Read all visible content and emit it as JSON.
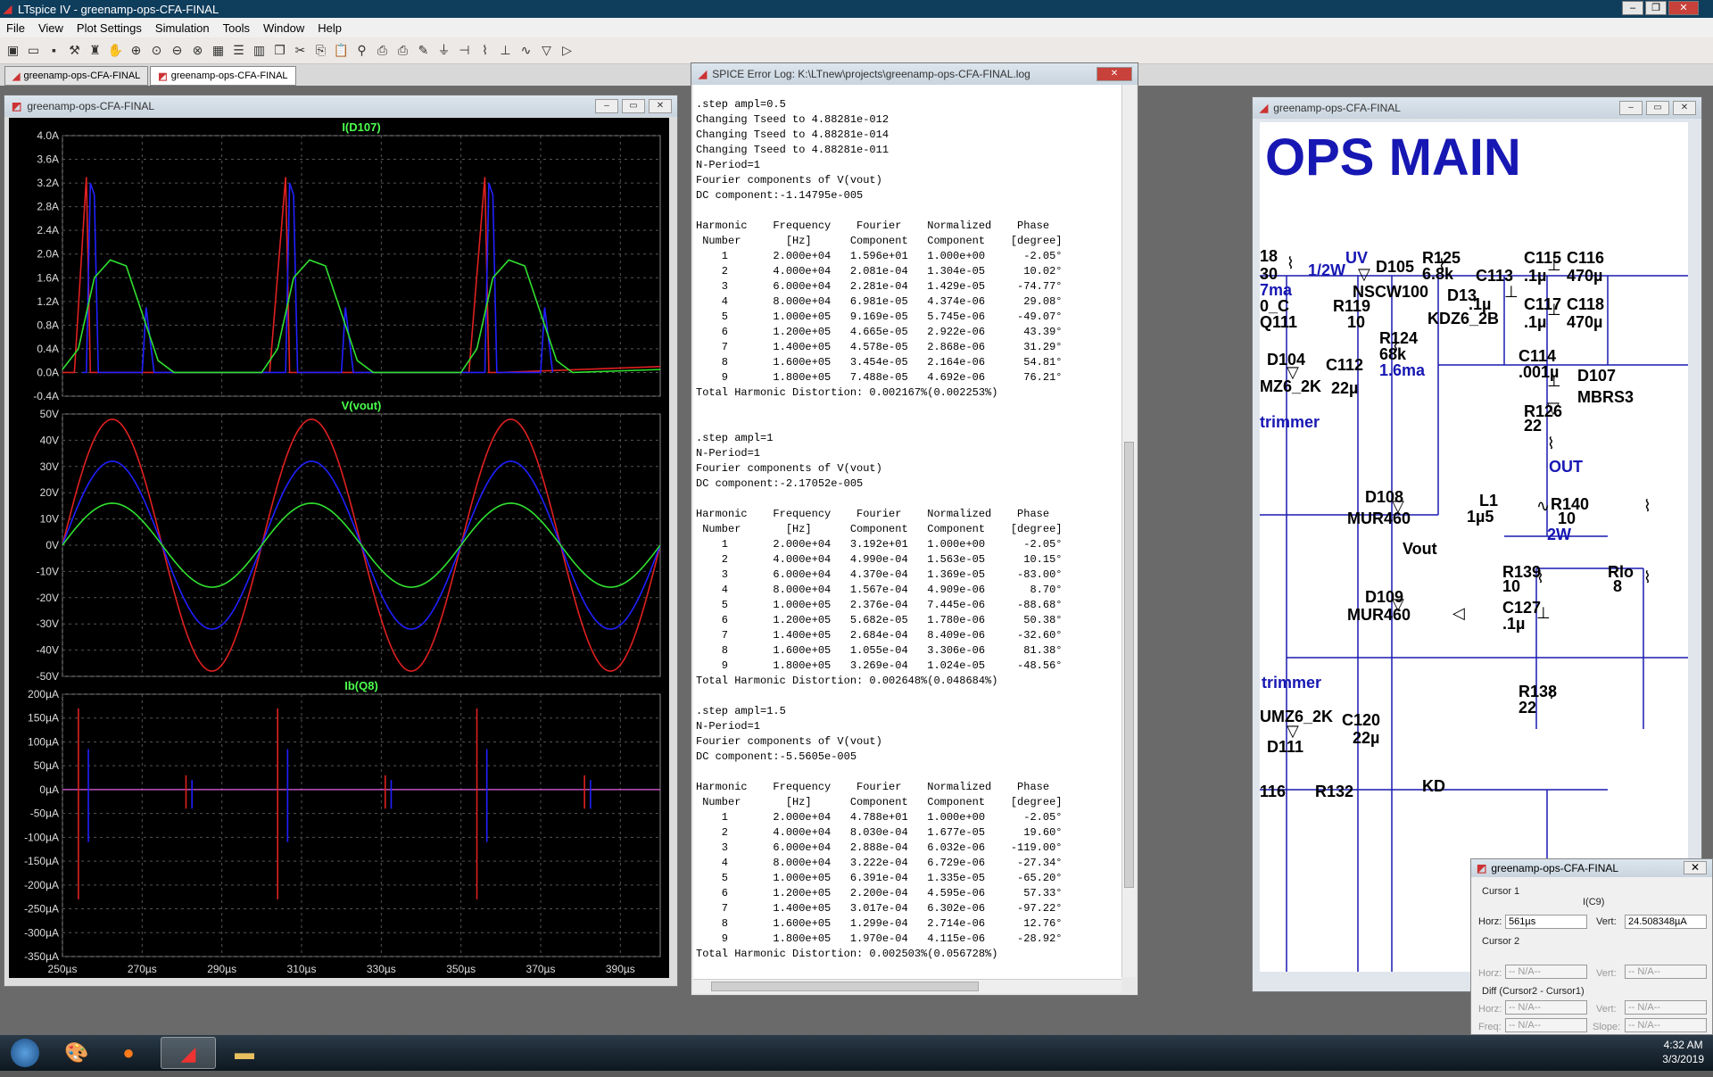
{
  "app": {
    "title": "LTspice IV - greenamp-ops-CFA-FINAL",
    "menu": [
      "File",
      "View",
      "Plot Settings",
      "Simulation",
      "Tools",
      "Window",
      "Help"
    ],
    "tabs": [
      "greenamp-ops-CFA-FINAL",
      "greenamp-ops-CFA-FINAL"
    ]
  },
  "waveform_window": {
    "title": "greenamp-ops-CFA-FINAL",
    "panes": [
      {
        "title": "I(D107)",
        "color": "#4cff4c",
        "yticks": [
          "4.0A",
          "3.6A",
          "3.2A",
          "2.8A",
          "2.4A",
          "2.0A",
          "1.6A",
          "1.2A",
          "0.8A",
          "0.4A",
          "0.0A",
          "-0.4A"
        ]
      },
      {
        "title": "V(vout)",
        "color": "#4cff4c",
        "yticks": [
          "50V",
          "40V",
          "30V",
          "20V",
          "10V",
          "0V",
          "-10V",
          "-20V",
          "-30V",
          "-40V",
          "-50V"
        ]
      },
      {
        "title": "Ib(Q8)",
        "color": "#4cff4c",
        "yticks": [
          "200µA",
          "150µA",
          "100µA",
          "50µA",
          "0µA",
          "-50µA",
          "-100µA",
          "-150µA",
          "-200µA",
          "-250µA",
          "-300µA",
          "-350µA"
        ]
      }
    ],
    "xticks": [
      "250µs",
      "270µs",
      "290µs",
      "310µs",
      "330µs",
      "350µs",
      "370µs",
      "390µs"
    ]
  },
  "chart_data": [
    {
      "type": "line",
      "title": "I(D107)",
      "ylim": [
        -0.4,
        4.0
      ],
      "xlim": [
        250,
        400
      ],
      "x_unit": "µs",
      "y_unit": "A",
      "series": [
        {
          "color": "#e02020",
          "x": [
            250,
            253,
            256,
            257,
            258,
            260,
            299,
            302,
            306,
            307,
            308,
            349,
            352,
            356,
            357,
            358,
            360,
            400
          ],
          "values": [
            0,
            0,
            3.3,
            0,
            0,
            0,
            0,
            0,
            3.3,
            0,
            0,
            0,
            0,
            3.3,
            0,
            0,
            0,
            0.1
          ]
        },
        {
          "color": "#2020ff",
          "x": [
            255,
            256,
            257,
            258,
            259,
            270,
            271,
            273,
            305,
            306,
            307,
            308,
            309,
            320,
            321,
            323,
            355,
            356,
            357,
            358,
            359,
            370,
            371,
            373
          ],
          "values": [
            0,
            0,
            3.2,
            3.0,
            0,
            0,
            1.1,
            0,
            0,
            0,
            3.2,
            3.0,
            0,
            0,
            1.1,
            0,
            0,
            0,
            3.2,
            3.0,
            0,
            0,
            1.1,
            0
          ]
        },
        {
          "color": "#30e030",
          "x": [
            250,
            254,
            258,
            262,
            266,
            270,
            274,
            278,
            300,
            304,
            308,
            312,
            316,
            320,
            324,
            328,
            350,
            354,
            358,
            362,
            366,
            370,
            374,
            378,
            400
          ],
          "values": [
            0.05,
            0.4,
            1.6,
            1.9,
            1.8,
            1.0,
            0.2,
            0,
            0,
            0.4,
            1.6,
            1.9,
            1.8,
            1.0,
            0.2,
            0,
            0,
            0.4,
            1.6,
            1.9,
            1.8,
            1.0,
            0.2,
            0,
            0.05
          ]
        }
      ]
    },
    {
      "type": "line",
      "title": "V(vout)",
      "ylim": [
        -50,
        50
      ],
      "xlim": [
        250,
        400
      ],
      "x_unit": "µs",
      "y_unit": "V",
      "period_us": 50,
      "series": [
        {
          "color": "#e02020",
          "amplitude": 48
        },
        {
          "color": "#2020ff",
          "amplitude": 32
        },
        {
          "color": "#30e030",
          "amplitude": 16
        }
      ]
    },
    {
      "type": "line",
      "title": "Ib(Q8)",
      "ylim": [
        -350,
        200
      ],
      "xlim": [
        250,
        400
      ],
      "x_unit": "µs",
      "y_unit": "µA",
      "spikes": [
        {
          "color": "#e02020",
          "x": [
            254,
            304,
            354
          ],
          "top": [
            170,
            170,
            170
          ],
          "bottom": [
            -230,
            -230,
            -230
          ]
        },
        {
          "color": "#2020ff",
          "x": [
            256.5,
            306.5,
            356.5
          ],
          "top": [
            85,
            85,
            85
          ],
          "bottom": [
            -110,
            -110,
            -110
          ]
        },
        {
          "color": "#e02020",
          "x": [
            281,
            331,
            381
          ],
          "top": [
            30,
            30,
            30
          ],
          "bottom": [
            -40,
            -40,
            -40
          ]
        },
        {
          "color": "#2020ff",
          "x": [
            282.5,
            332.5,
            382.5
          ],
          "top": [
            20,
            20,
            20
          ],
          "bottom": [
            -40,
            -40,
            -40
          ]
        }
      ]
    }
  ],
  "log_window": {
    "title": "SPICE Error Log: K:\\LTnew\\projects\\greenamp-ops-CFA-FINAL.log",
    "lines": [
      ".step ampl=0.5",
      "Changing Tseed to 4.88281e-012",
      "Changing Tseed to 4.88281e-014",
      "Changing Tseed to 4.88281e-011",
      "N-Period=1",
      "Fourier components of V(vout)",
      "DC component:-1.14795e-005",
      "",
      "Harmonic    Frequency    Fourier    Normalized    Phase",
      " Number       [Hz]      Component   Component    [degree]",
      "    1       2.000e+04   1.596e+01   1.000e+00      -2.05°",
      "    2       4.000e+04   2.081e-04   1.304e-05      10.02°",
      "    3       6.000e+04   2.281e-04   1.429e-05     -74.77°",
      "    4       8.000e+04   6.981e-05   4.374e-06      29.08°",
      "    5       1.000e+05   9.169e-05   5.745e-06     -49.07°",
      "    6       1.200e+05   4.665e-05   2.922e-06      43.39°",
      "    7       1.400e+05   4.578e-05   2.868e-06      31.29°",
      "    8       1.600e+05   3.454e-05   2.164e-06      54.81°",
      "    9       1.800e+05   7.488e-05   4.692e-06      76.21°",
      "Total Harmonic Distortion: 0.002167%(0.002253%)",
      "",
      "",
      ".step ampl=1",
      "N-Period=1",
      "Fourier components of V(vout)",
      "DC component:-2.17052e-005",
      "",
      "Harmonic    Frequency    Fourier    Normalized    Phase",
      " Number       [Hz]      Component   Component    [degree]",
      "    1       2.000e+04   3.192e+01   1.000e+00      -2.05°",
      "    2       4.000e+04   4.990e-04   1.563e-05      10.15°",
      "    3       6.000e+04   4.370e-04   1.369e-05     -83.00°",
      "    4       8.000e+04   1.567e-04   4.909e-06       8.70°",
      "    5       1.000e+05   2.376e-04   7.445e-06     -88.68°",
      "    6       1.200e+05   5.682e-05   1.780e-06      50.38°",
      "    7       1.400e+05   2.684e-04   8.409e-06     -32.60°",
      "    8       1.600e+05   1.055e-04   3.306e-06      81.38°",
      "    9       1.800e+05   3.269e-04   1.024e-05     -48.56°",
      "Total Harmonic Distortion: 0.002648%(0.048684%)",
      "",
      ".step ampl=1.5",
      "N-Period=1",
      "Fourier components of V(vout)",
      "DC component:-5.5605e-005",
      "",
      "Harmonic    Frequency    Fourier    Normalized    Phase",
      " Number       [Hz]      Component   Component    [degree]",
      "    1       2.000e+04   4.788e+01   1.000e+00      -2.05°",
      "    2       4.000e+04   8.030e-04   1.677e-05      19.60°",
      "    3       6.000e+04   2.888e-04   6.032e-06    -119.00°",
      "    4       8.000e+04   3.222e-04   6.729e-06     -27.34°",
      "    5       1.000e+05   6.391e-04   1.335e-05     -65.20°",
      "    6       1.200e+05   2.200e-04   4.595e-06      57.33°",
      "    7       1.400e+05   3.017e-04   6.302e-06     -97.22°",
      "    8       1.600e+05   1.299e-04   2.714e-06      12.76°",
      "    9       1.800e+05   1.970e-04   4.115e-06     -28.92°",
      "Total Harmonic Distortion: 0.002503%(0.056728%)"
    ]
  },
  "schematic_window": {
    "title": "greenamp-ops-CFA-FINAL",
    "heading": "OPS MAIN",
    "labels": [
      {
        "t": "18",
        "c": "k"
      },
      {
        "t": "30",
        "c": "k"
      },
      {
        "t": "1/2W",
        "c": "b"
      },
      {
        "t": "UV",
        "c": "b"
      },
      {
        "t": "D105",
        "c": "k"
      },
      {
        "t": "R125",
        "c": "k"
      },
      {
        "t": "6.8k",
        "c": "k"
      },
      {
        "t": "C113",
        "c": "k"
      },
      {
        "t": "C115",
        "c": "k"
      },
      {
        "t": ".1µ",
        "c": "k"
      },
      {
        "t": "C116",
        "c": "k"
      },
      {
        "t": "470µ",
        "c": "k"
      },
      {
        "t": "7ma",
        "c": "b"
      },
      {
        "t": "NSCW100",
        "c": "k"
      },
      {
        "t": "D13",
        "c": "k"
      },
      {
        "t": ".1µ",
        "c": "k"
      },
      {
        "t": "0_C",
        "c": "k"
      },
      {
        "t": "R119",
        "c": "k"
      },
      {
        "t": "C117",
        "c": "k"
      },
      {
        "t": "C118",
        "c": "k"
      },
      {
        "t": ".1µ",
        "c": "k"
      },
      {
        "t": "470µ",
        "c": "k"
      },
      {
        "t": "Q111",
        "c": "k"
      },
      {
        "t": "10",
        "c": "k"
      },
      {
        "t": "KDZ6_2B",
        "c": "k"
      },
      {
        "t": "R124",
        "c": "k"
      },
      {
        "t": "68k",
        "c": "k"
      },
      {
        "t": "1.6ma",
        "c": "b"
      },
      {
        "t": "D104",
        "c": "k"
      },
      {
        "t": "C114",
        "c": "k"
      },
      {
        "t": ".001µ",
        "c": "k"
      },
      {
        "t": "C112",
        "c": "k"
      },
      {
        "t": "D107",
        "c": "k"
      },
      {
        "t": "MZ6_2K",
        "c": "k"
      },
      {
        "t": "22µ",
        "c": "k"
      },
      {
        "t": "MBRS3",
        "c": "k"
      },
      {
        "t": "R126",
        "c": "k"
      },
      {
        "t": "22",
        "c": "k"
      },
      {
        "t": "trimmer",
        "c": "b"
      },
      {
        "t": "OUT",
        "c": "b"
      },
      {
        "t": "D108",
        "c": "k"
      },
      {
        "t": "L1",
        "c": "k"
      },
      {
        "t": "1µ5",
        "c": "k"
      },
      {
        "t": "R140",
        "c": "k"
      },
      {
        "t": "10",
        "c": "k"
      },
      {
        "t": "2W",
        "c": "b"
      },
      {
        "t": "MUR460",
        "c": "k"
      },
      {
        "t": "Vout",
        "c": "k"
      },
      {
        "t": "R139",
        "c": "k"
      },
      {
        "t": "10",
        "c": "k"
      },
      {
        "t": "Rlo",
        "c": "k"
      },
      {
        "t": "8",
        "c": "k"
      },
      {
        "t": "D109",
        "c": "k"
      },
      {
        "t": "C127",
        "c": "k"
      },
      {
        "t": "MUR460",
        "c": "k"
      },
      {
        "t": ".1µ",
        "c": "k"
      },
      {
        "t": "trimmer",
        "c": "b"
      },
      {
        "t": "R138",
        "c": "k"
      },
      {
        "t": "22",
        "c": "k"
      },
      {
        "t": "UMZ6_2K",
        "c": "k"
      },
      {
        "t": "C120",
        "c": "k"
      },
      {
        "t": "22µ",
        "c": "k"
      },
      {
        "t": "D111",
        "c": "k"
      },
      {
        "t": "116",
        "c": "k"
      },
      {
        "t": "R132",
        "c": "k"
      },
      {
        "t": "KD",
        "c": "k"
      }
    ]
  },
  "cursor_window": {
    "title": "greenamp-ops-CFA-FINAL",
    "cursor1": "Cursor 1",
    "trace": "I(C9)",
    "horz_label": "Horz:",
    "horz": "561µs",
    "vert_label": "Vert:",
    "vert": "24.508348µA",
    "cursor2": "Cursor 2",
    "na": "-- N/A--",
    "diff": "Diff (Cursor2 - Cursor1)",
    "freq_label": "Freq:",
    "slope_label": "Slope:"
  },
  "taskbar": {
    "time": "4:32 AM",
    "date": "3/3/2019"
  }
}
